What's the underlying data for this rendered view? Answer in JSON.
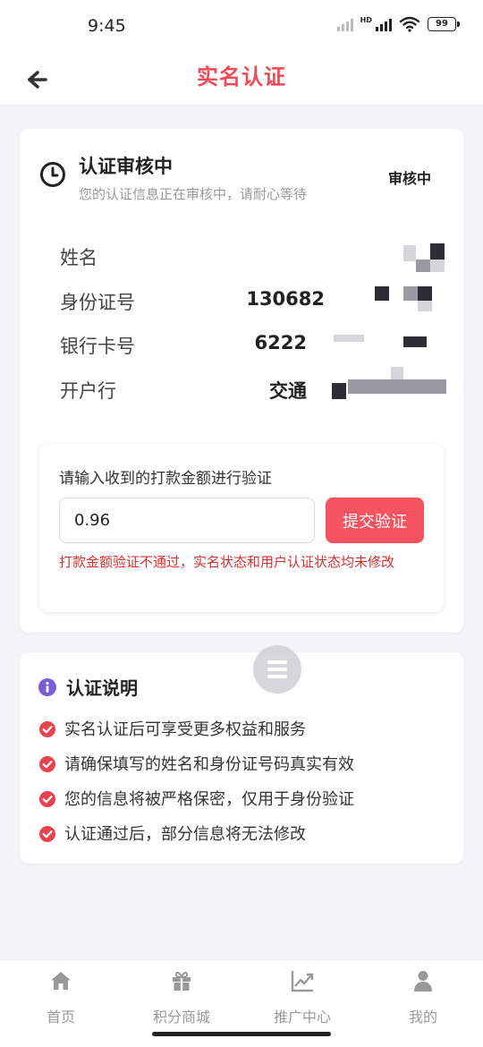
{
  "status_bar": {
    "time": "9:45",
    "hd_label": "HD",
    "battery": "99"
  },
  "nav": {
    "title": "实名认证"
  },
  "status": {
    "title": "认证审核中",
    "subtitle": "您的认证信息正在审核中，请耐心等待",
    "badge": "审核中"
  },
  "info": {
    "rows": [
      {
        "label": "姓名",
        "value": ""
      },
      {
        "label": "身份证号",
        "value": "130682"
      },
      {
        "label": "银行卡号",
        "value": "6222"
      },
      {
        "label": "开户行",
        "value": "交通"
      }
    ]
  },
  "verify": {
    "title": "请输入收到的打款金额进行验证",
    "amount_value": "0.96",
    "submit_label": "提交验证",
    "error": "打款金额验证不通过，实名状态和用户认证状态均未修改"
  },
  "notes": {
    "title": "认证说明",
    "items": [
      "实名认证后可享受更多权益和服务",
      "请确保填写的姓名和身份证号码真实有效",
      "您的信息将被严格保密，仅用于身份验证",
      "认证通过后，部分信息将无法修改"
    ]
  },
  "tabbar": {
    "items": [
      {
        "label": "首页",
        "icon": "home-icon"
      },
      {
        "label": "积分商城",
        "icon": "gift-icon"
      },
      {
        "label": "推广中心",
        "icon": "chart-icon"
      },
      {
        "label": "我的",
        "icon": "user-icon"
      }
    ]
  },
  "colors": {
    "accent": "#ef4a57",
    "button": "#f4545f",
    "error": "#d62f2f",
    "check": "#e8434e",
    "info_icon": "#7a5ed6",
    "tab_inactive": "#999999"
  }
}
